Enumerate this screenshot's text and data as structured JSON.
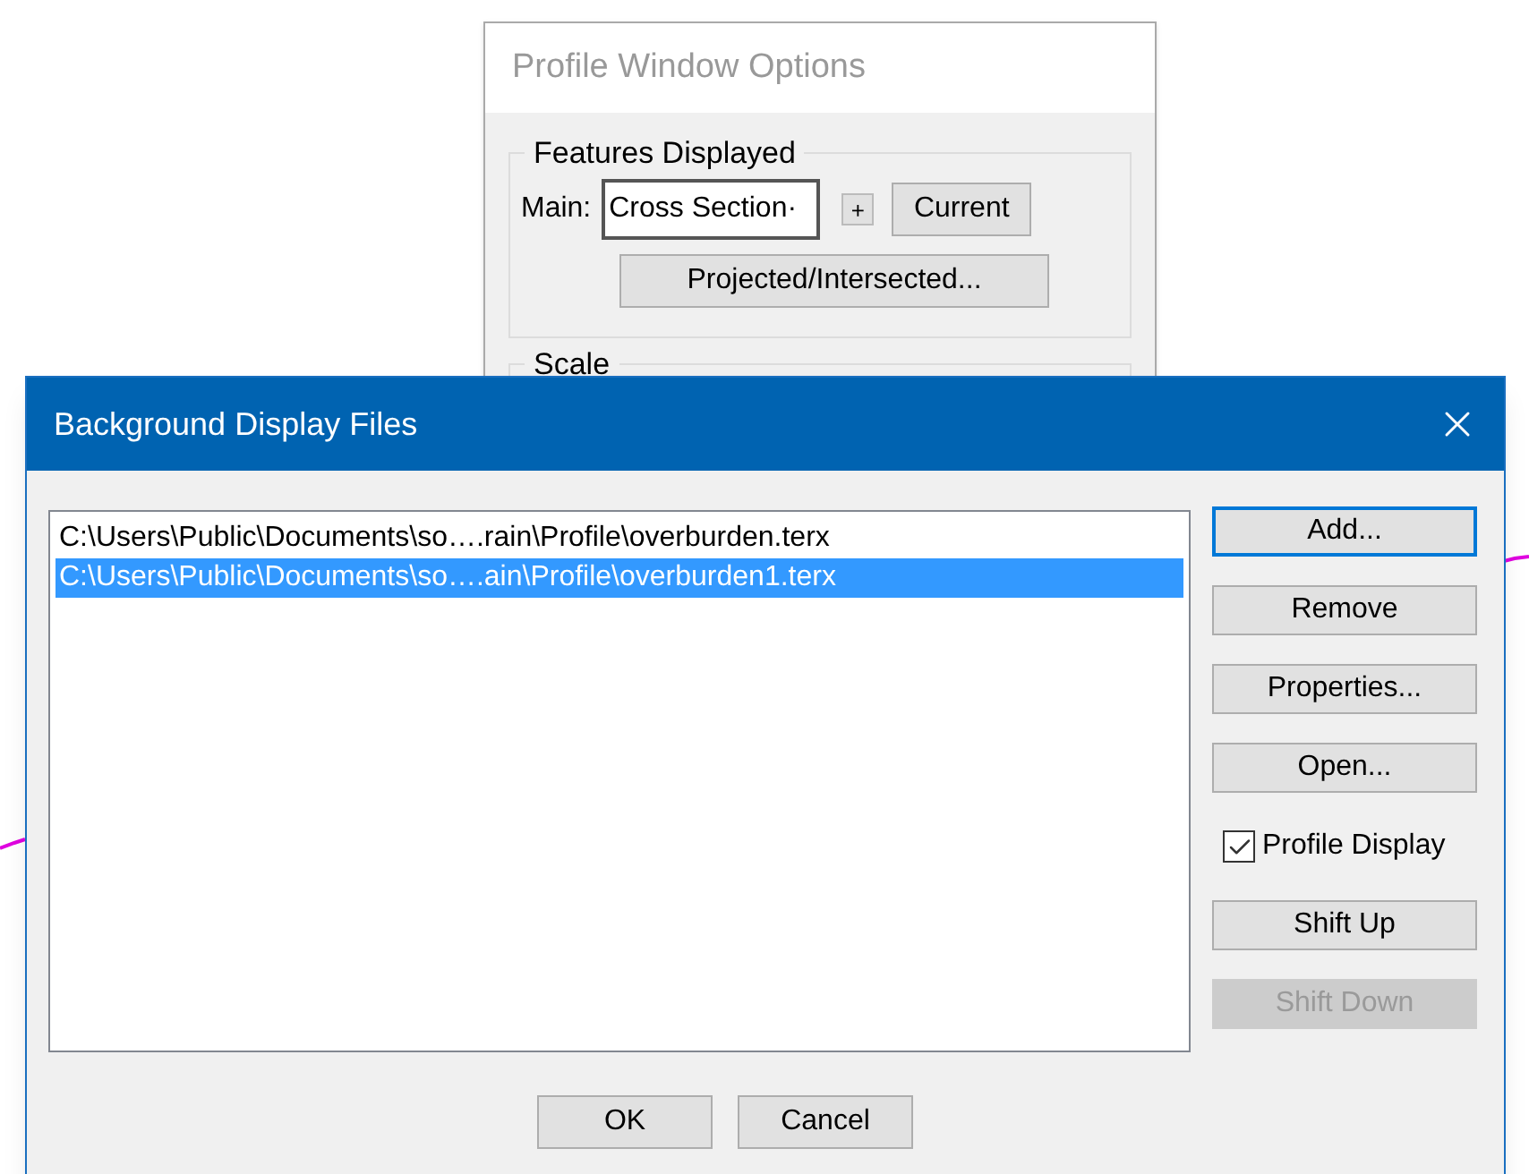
{
  "back_window": {
    "title": "Profile Window Options",
    "group": {
      "label": "Features Displayed",
      "main_label": "Main:",
      "main_value": "Cross Section·",
      "plus_button": "+",
      "current_button": "Current",
      "projected_button": "Projected/Intersected..."
    },
    "scale_label": "Scale"
  },
  "dialog": {
    "title": "Background Display Files",
    "files": [
      {
        "path": "C:\\Users\\Public\\Documents\\so….rain\\Profile\\overburden.terx",
        "selected": false
      },
      {
        "path": "C:\\Users\\Public\\Documents\\so….ain\\Profile\\overburden1.terx",
        "selected": true
      }
    ],
    "side_controls": [
      {
        "kind": "button",
        "label": "Add...",
        "disabled": false,
        "focused": true
      },
      {
        "kind": "button",
        "label": "Remove",
        "disabled": false,
        "focused": false
      },
      {
        "kind": "button",
        "label": "Properties...",
        "disabled": false,
        "focused": false
      },
      {
        "kind": "button",
        "label": "Open...",
        "disabled": false,
        "focused": false
      },
      {
        "kind": "checkbox",
        "label": "Profile Display",
        "checked": true
      },
      {
        "kind": "button",
        "label": "Shift Up",
        "disabled": false,
        "focused": false
      },
      {
        "kind": "button",
        "label": "Shift Down",
        "disabled": true,
        "focused": false
      }
    ],
    "footer_buttons": [
      "OK",
      "Cancel"
    ]
  }
}
